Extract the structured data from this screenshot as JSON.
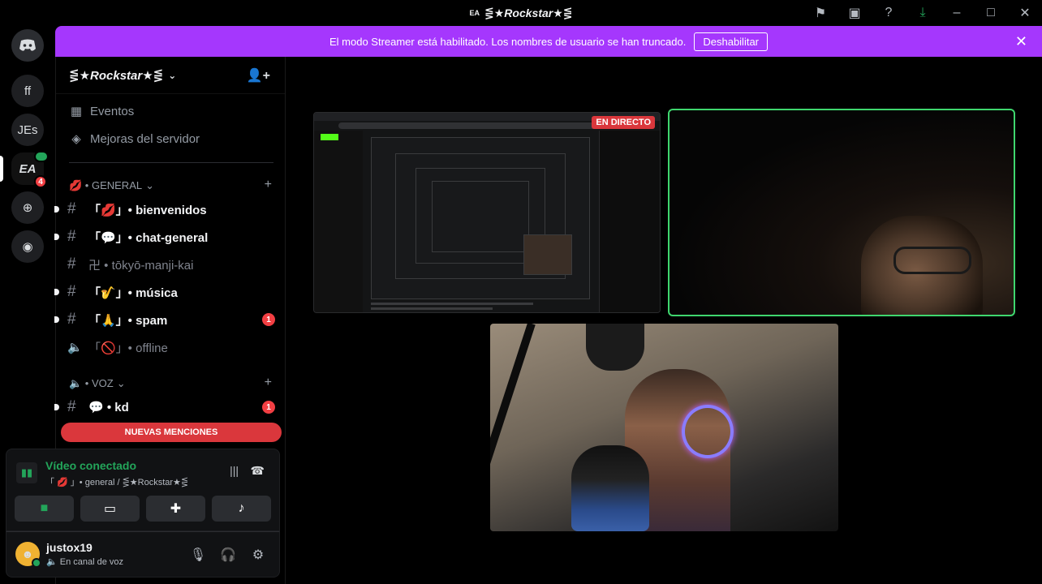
{
  "window": {
    "title": "⋚★Rockstar★⋚",
    "title_prefix": "EA"
  },
  "banner": {
    "message": "El modo Streamer está habilitado. Los nombres de usuario se han truncado.",
    "button": "Deshabilitar"
  },
  "rail": {
    "servers": [
      {
        "label": "ff"
      },
      {
        "label": "JEs"
      },
      {
        "label": "EA",
        "badge": "4"
      }
    ]
  },
  "server": {
    "name": "⋚★Rockstar★⋚"
  },
  "nav": {
    "events": "Eventos",
    "boosts": "Mejoras del servidor"
  },
  "categories": {
    "general": "💋 • GENERAL",
    "voz": "🔈 • VOZ"
  },
  "channels": [
    {
      "name": "「💋」• bienvenidos"
    },
    {
      "name": "「💬」• chat-general"
    },
    {
      "name": "卍 • tōkyō-manji-kai"
    },
    {
      "name": "「🎷」• música"
    },
    {
      "name": "「🙏」• spam",
      "mentions": "1"
    },
    {
      "name": "「🚫」• offline"
    },
    {
      "name": "💬 • kd",
      "mentions": "1"
    }
  ],
  "new_mentions": "NUEVAS MENCIONES",
  "voice": {
    "status": "Vídeo conectado",
    "location": "「 💋 」• general / ⋚★Rockstar★⋚"
  },
  "user": {
    "name": "justox19",
    "status": "En canal de voz"
  },
  "stream": {
    "live_label": "EN DIRECTO"
  }
}
